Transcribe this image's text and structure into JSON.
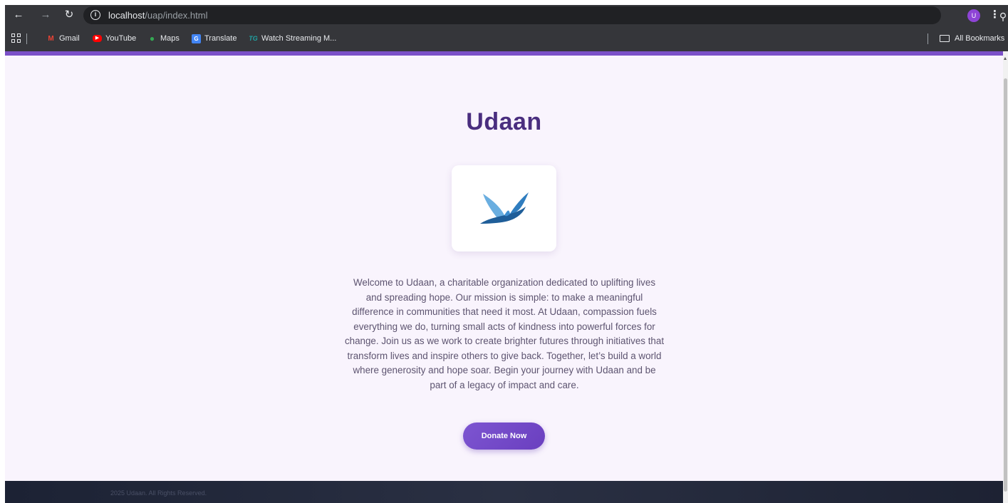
{
  "browser": {
    "url_host": "localhost",
    "url_path": "/uap/index.html",
    "profile_initial": "U",
    "bookmarks": [
      {
        "label": "Gmail",
        "icon": "gmail-icon"
      },
      {
        "label": "YouTube",
        "icon": "youtube-icon"
      },
      {
        "label": "Maps",
        "icon": "maps-icon"
      },
      {
        "label": "Translate",
        "icon": "translate-icon"
      },
      {
        "label": "Watch Streaming M...",
        "icon": "tg-icon"
      }
    ],
    "all_bookmarks": "All Bookmarks"
  },
  "colors": {
    "accent": "#7b50c8",
    "title": "#4a2e7f",
    "page_bg": "#f9f4fd",
    "footer_bg": "#1f2537"
  },
  "main": {
    "title": "Udaan",
    "description": "Welcome to Udaan, a charitable organization dedicated to uplifting lives and spreading hope. Our mission is simple: to make a meaningful difference in communities that need it most. At Udaan, compassion fuels everything we do, turning small acts of kindness into powerful forces for change. Join us as we work to create brighter futures through initiatives that transform lives and inspire others to give back. Together, let’s build a world where generosity and hope soar. Begin your journey with Udaan and be part of a legacy of impact and care.",
    "donate_label": "Donate Now"
  },
  "footer": {
    "copyright": "2025 Udaan. All Rights Reserved."
  }
}
